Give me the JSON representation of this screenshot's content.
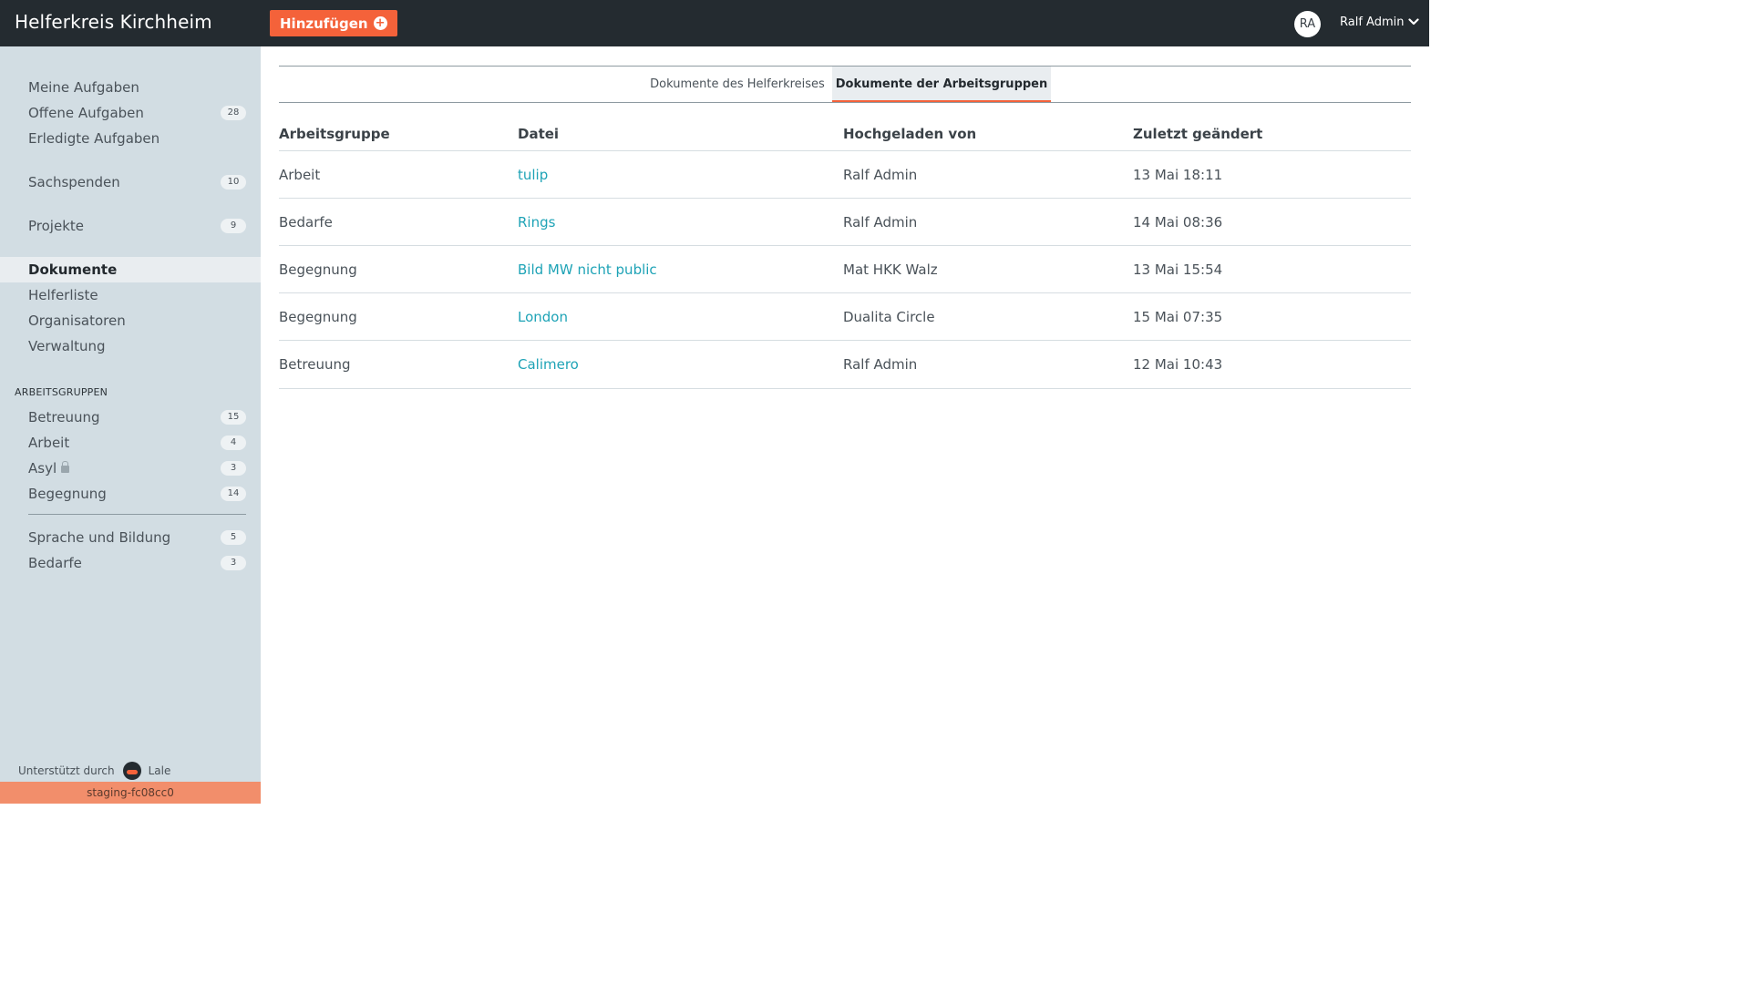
{
  "app": {
    "title": "Helferkreis Kirchheim",
    "add_label": "Hinzufügen",
    "user_initials": "RA",
    "user_name": "Ralf Admin"
  },
  "sidebar": {
    "items": [
      {
        "label": "Meine Aufgaben",
        "badge": ""
      },
      {
        "label": "Offene Aufgaben",
        "badge": "28"
      },
      {
        "label": "Erledigte Aufgaben",
        "badge": ""
      },
      {
        "label": "Sachspenden",
        "badge": "10"
      },
      {
        "label": "Projekte",
        "badge": "9"
      },
      {
        "label": "Dokumente",
        "badge": "",
        "active": true
      },
      {
        "label": "Helferliste",
        "badge": ""
      },
      {
        "label": "Organisatoren",
        "badge": ""
      },
      {
        "label": "Verwaltung",
        "badge": ""
      }
    ],
    "groups_heading": "ARBEITSGRUPPEN",
    "groups": [
      {
        "label": "Betreuung",
        "badge": "15"
      },
      {
        "label": "Arbeit",
        "badge": "4"
      },
      {
        "label": "Asyl",
        "badge": "3",
        "locked": true
      },
      {
        "label": "Begegnung",
        "badge": "14"
      },
      {
        "label": "Sprache und Bildung",
        "badge": "5"
      },
      {
        "label": "Bedarfe",
        "badge": "3"
      }
    ],
    "supported_by": "Unterstützt durch",
    "supported_brand": "Lale",
    "staging": "staging-fc08cc0"
  },
  "tabs": [
    {
      "label": "Dokumente des Helferkreises"
    },
    {
      "label": "Dokumente der Arbeitsgruppen",
      "active": true
    }
  ],
  "table": {
    "headers": [
      "Arbeitsgruppe",
      "Datei",
      "Hochgeladen von",
      "Zuletzt geändert"
    ],
    "rows": [
      {
        "group": "Arbeit",
        "file": "tulip",
        "uploader": "Ralf Admin",
        "modified": "13 Mai 18:11"
      },
      {
        "group": "Bedarfe",
        "file": "Rings",
        "uploader": "Ralf Admin",
        "modified": "14 Mai 08:36"
      },
      {
        "group": "Begegnung",
        "file": "Bild MW nicht public",
        "uploader": "Mat HKK Walz",
        "modified": "13 Mai 15:54"
      },
      {
        "group": "Begegnung",
        "file": "London",
        "uploader": "Dualita Circle",
        "modified": "15 Mai 07:35"
      },
      {
        "group": "Betreuung",
        "file": "Calimero",
        "uploader": "Ralf Admin",
        "modified": "12 Mai 10:43"
      }
    ]
  }
}
